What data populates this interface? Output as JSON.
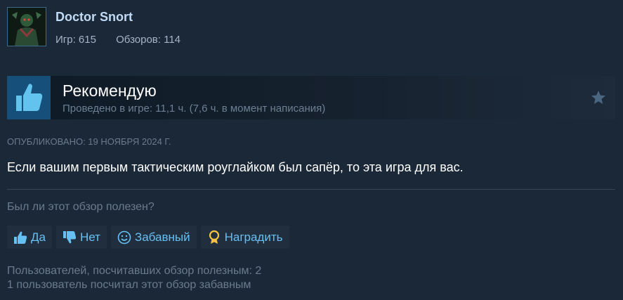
{
  "author": {
    "name": "Doctor Snort",
    "games": "Игр: 615",
    "reviews": "Обзоров: 114"
  },
  "recommendation": {
    "title": "Рекомендую",
    "hours": "Проведено в игре: 11,1 ч. (7,6 ч. в момент написания)"
  },
  "posted": "ОПУБЛИКОВАНО: 19 НОЯБРЯ 2024 Г.",
  "review_text": "Если вашим первым тактическим роуглайком был сапёр, то эта игра для вас.",
  "helpful_question": "Был ли этот обзор полезен?",
  "buttons": {
    "yes": {
      "label": "Да",
      "icon": "thumbs-up-icon"
    },
    "no": {
      "label": "Нет",
      "icon": "thumbs-down-icon"
    },
    "funny": {
      "label": "Забавный",
      "icon": "smile-icon"
    },
    "award": {
      "label": "Наградить",
      "icon": "award-medal-icon"
    }
  },
  "stats": {
    "helpful": "Пользователей, посчитавших обзор полезным: 2",
    "funny": "1 пользователь посчитал этот обзор забавным"
  },
  "colors": {
    "background": "#1b2838",
    "accent": "#66c0f4",
    "thumb_box": "#16507a",
    "award_gold": "#f5c242"
  }
}
